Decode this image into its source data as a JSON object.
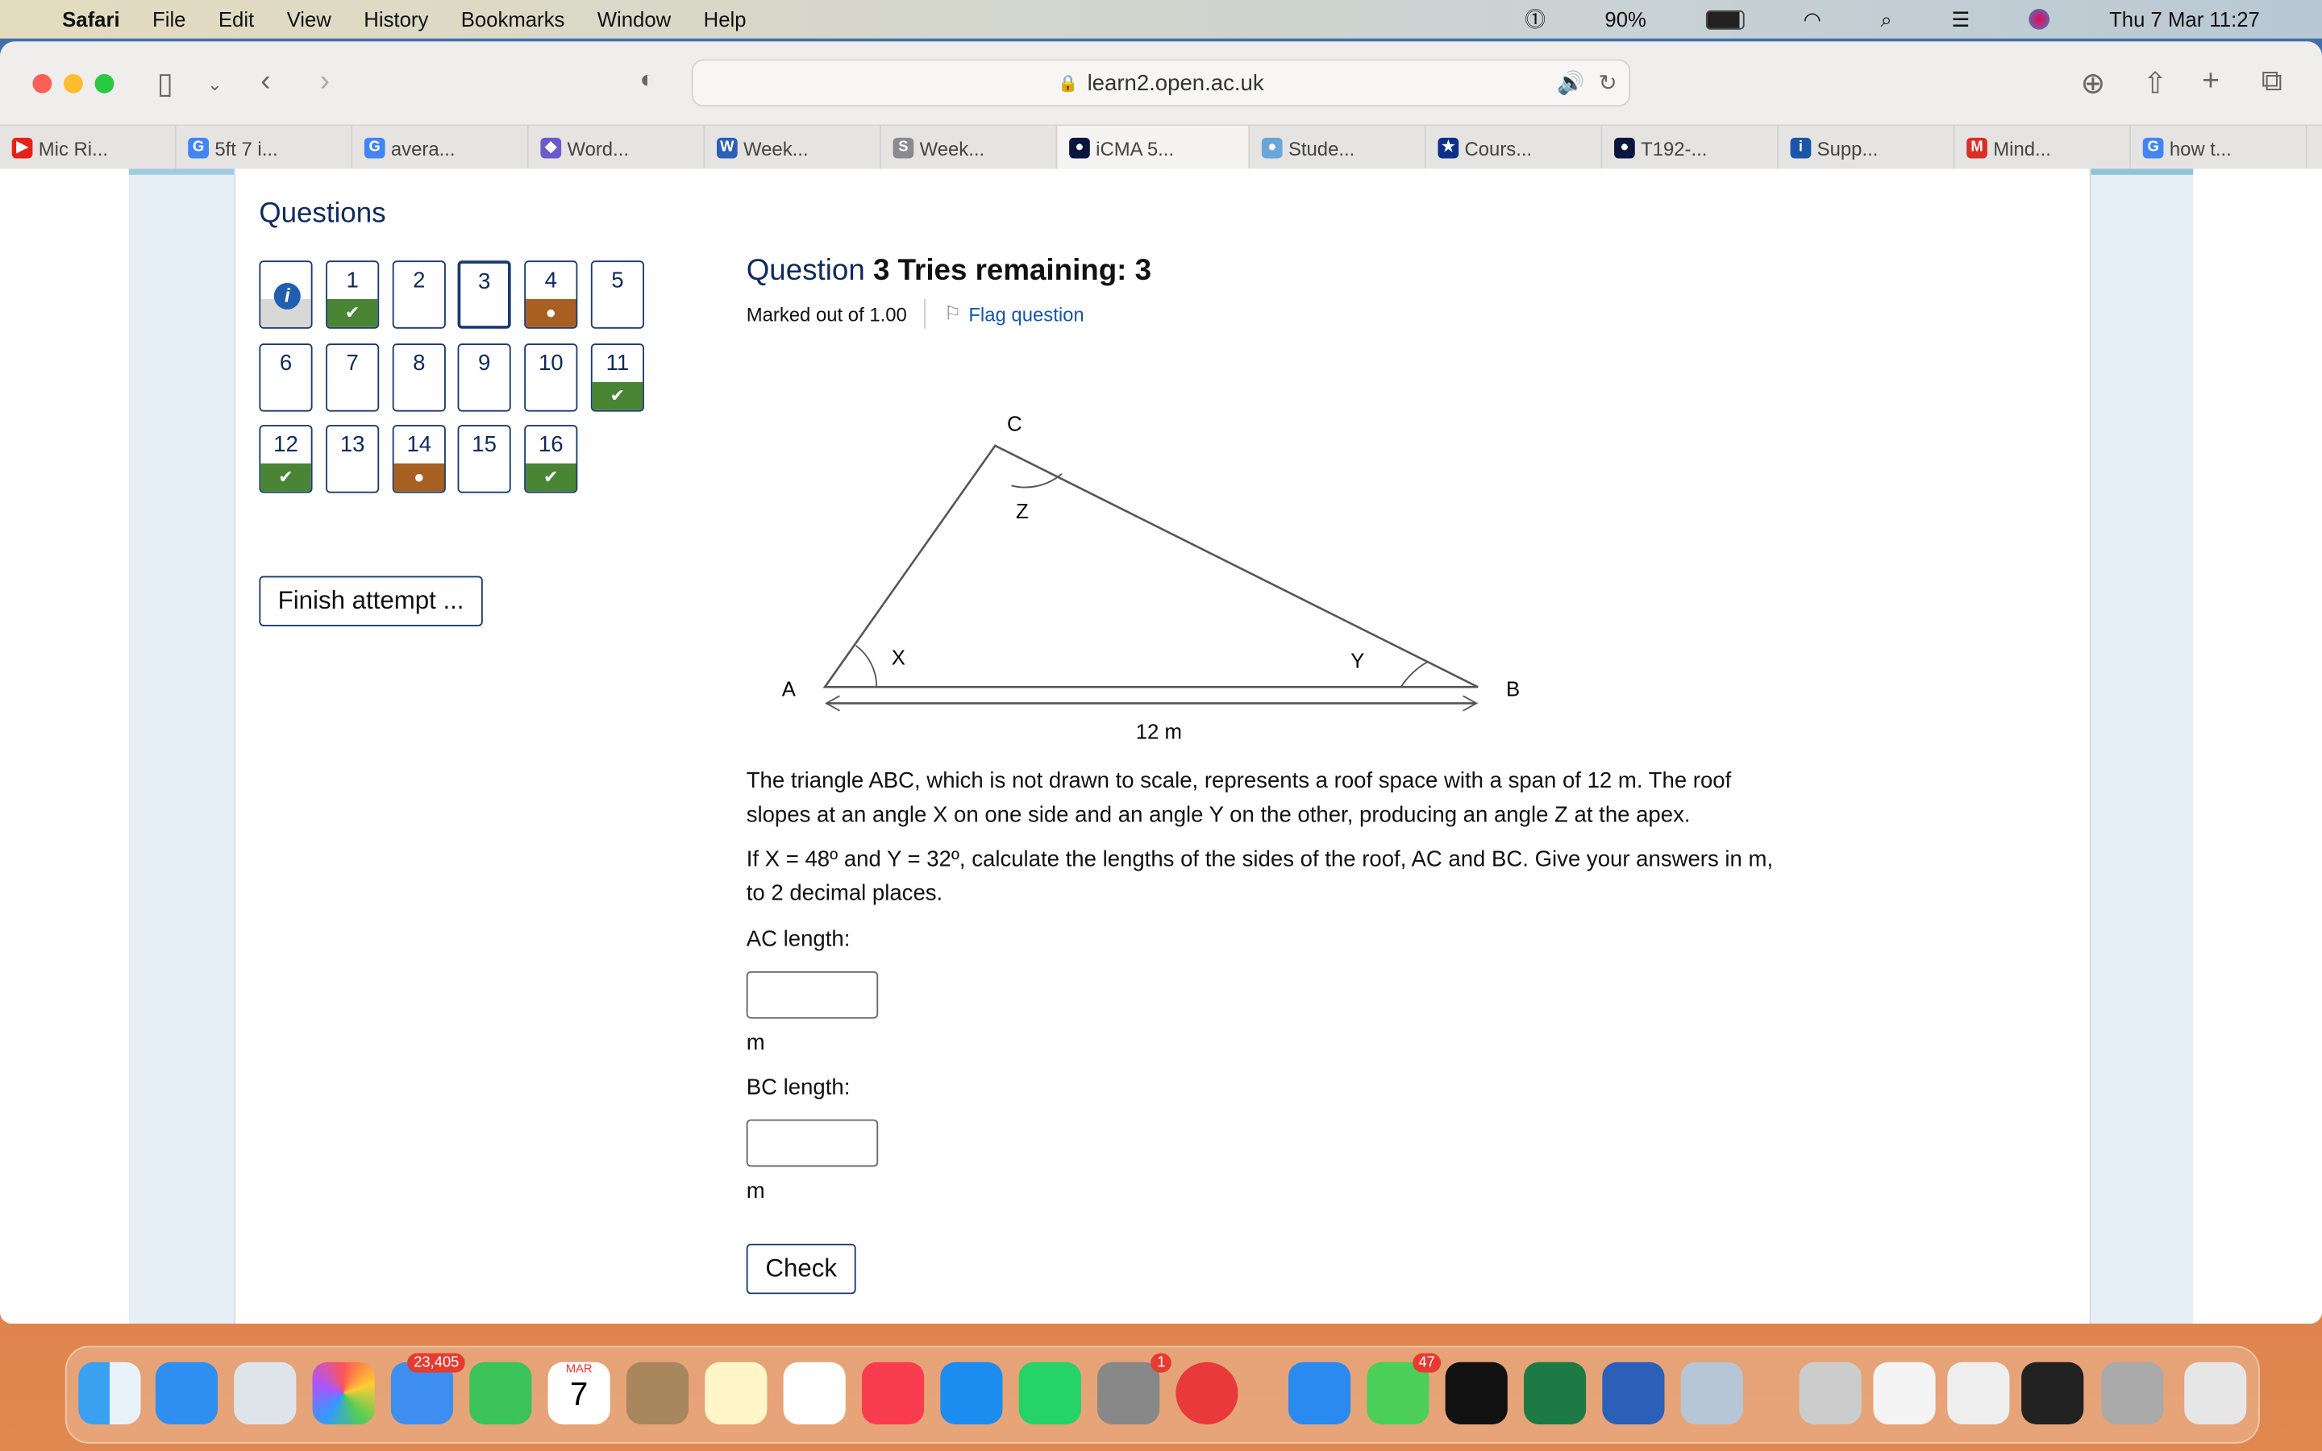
{
  "menubar": {
    "app": "Safari",
    "items": [
      "File",
      "Edit",
      "View",
      "History",
      "Bookmarks",
      "Window",
      "Help"
    ],
    "battery": "90%",
    "datetime": "Thu 7 Mar  11:27"
  },
  "browser": {
    "url": "learn2.open.ac.uk",
    "tabs": [
      {
        "label": "Mic Ri...",
        "color": "#e62117",
        "glyph": "▶"
      },
      {
        "label": "5ft 7 i...",
        "color": "#4285f4",
        "glyph": "G"
      },
      {
        "label": "avera...",
        "color": "#4285f4",
        "glyph": "G"
      },
      {
        "label": "Word...",
        "color": "#6a5acd",
        "glyph": "◆"
      },
      {
        "label": "Week...",
        "color": "#2b5fb8",
        "glyph": "W"
      },
      {
        "label": "Week...",
        "color": "#8a8a92",
        "glyph": "S"
      },
      {
        "label": "iCMA 5...",
        "color": "#0a1540",
        "glyph": "●"
      },
      {
        "label": "Stude...",
        "color": "#6aa6d8",
        "glyph": "●"
      },
      {
        "label": "Cours...",
        "color": "#0b2f8a",
        "glyph": "★"
      },
      {
        "label": "T192-...",
        "color": "#0a1540",
        "glyph": "●"
      },
      {
        "label": "Supp...",
        "color": "#1a56a8",
        "glyph": "i"
      },
      {
        "label": "Mind...",
        "color": "#d93025",
        "glyph": "M"
      },
      {
        "label": "how t...",
        "color": "#4285f4",
        "glyph": "G"
      }
    ],
    "active_tab": 6
  },
  "quiz": {
    "nav_title": "Questions",
    "questions": [
      {
        "n": "1",
        "state": "correct"
      },
      {
        "n": "2",
        "state": ""
      },
      {
        "n": "3",
        "state": "current"
      },
      {
        "n": "4",
        "state": "partial"
      },
      {
        "n": "5",
        "state": ""
      },
      {
        "n": "6",
        "state": ""
      },
      {
        "n": "7",
        "state": ""
      },
      {
        "n": "8",
        "state": ""
      },
      {
        "n": "9",
        "state": ""
      },
      {
        "n": "10",
        "state": ""
      },
      {
        "n": "11",
        "state": "correct"
      },
      {
        "n": "12",
        "state": "correct"
      },
      {
        "n": "13",
        "state": ""
      },
      {
        "n": "14",
        "state": "partial"
      },
      {
        "n": "15",
        "state": ""
      },
      {
        "n": "16",
        "state": "correct"
      }
    ],
    "finish_label": "Finish attempt ...",
    "q_label": "Question",
    "q_number": "3",
    "tries": "Tries remaining: 3",
    "marked": "Marked out of 1.00",
    "flag": "Flag question",
    "diagram": {
      "C": "C",
      "Z": "Z",
      "X": "X",
      "Y": "Y",
      "A": "A",
      "B": "B",
      "span": "12 m"
    },
    "text1": "The triangle ABC, which is not drawn to scale, represents a roof space with a span of 12 m. The roof slopes at an angle X on one side and an angle Y on the other, producing an angle Z at the apex.",
    "text2": "If X = 48º and Y = 32º, calculate the lengths of the sides of the roof, AC and BC. Give your answers in m, to 2 decimal places.",
    "ac_label": "AC length:",
    "bc_label": "BC length:",
    "unit": "m",
    "ac_value": "",
    "bc_value": "",
    "check_label": "Check"
  },
  "dock": {
    "mail_badge": "23,405",
    "settings_badge": "1",
    "messages_badge": "47",
    "calendar_month": "MAR",
    "calendar_day": "7"
  }
}
